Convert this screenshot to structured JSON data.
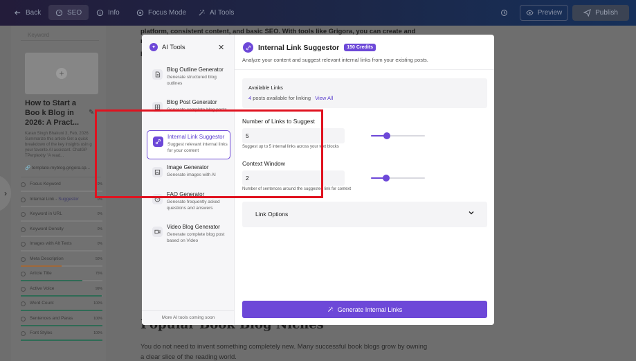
{
  "topbar": {
    "back": "Back",
    "seo": "SEO",
    "info": "Info",
    "focus_mode": "Focus Mode",
    "ai_tools": "AI Tools",
    "preview": "Preview",
    "publish": "Publish"
  },
  "sidebar": {
    "keyword_placeholder": "Keyword",
    "post_title": "How to Start a Boo k Blog in 2026: A Pract...",
    "post_excerpt": "Karan Singh Bhakuni 3, Feb, 2026 Summarize this article Get a quick breakdown of the key insights usin g your favorite AI assistant. ChatGP TPerplexity \"A read...",
    "post_url": "template-myblog.grigora.sp...",
    "checks": [
      {
        "label": "Focus Keyword",
        "value": "0%",
        "progress": 0,
        "color": "#7d7d7d"
      },
      {
        "label": "Internal Link - ",
        "highlight": "Suggestor",
        "value": "0%",
        "progress": 0,
        "color": "#7d7d7d"
      },
      {
        "label": "Keyword in URL",
        "value": "0%",
        "progress": 0,
        "color": "#7d7d7d"
      },
      {
        "label": "Keyword Density",
        "value": "0%",
        "progress": 0,
        "color": "#7d7d7d"
      },
      {
        "label": "Images with Alt Texts",
        "value": "0%",
        "progress": 0,
        "color": "#7d7d7d"
      },
      {
        "label": "Meta Description",
        "value": "50%",
        "progress": 0.5,
        "color": "#a0683a"
      },
      {
        "label": "Article Title",
        "value": "75%",
        "progress": 0.75,
        "color": "#2f6b55"
      },
      {
        "label": "Active Voice",
        "value": "99%",
        "progress": 0.99,
        "color": "#2f6b55"
      },
      {
        "label": "Word Count",
        "value": "100%",
        "progress": 1.0,
        "color": "#2f6b55"
      },
      {
        "label": "Sentences and Paras",
        "value": "100%",
        "progress": 1.0,
        "color": "#2f6b55"
      },
      {
        "label": "Font Styles",
        "value": "100%",
        "progress": 1.0,
        "color": "#2f6b55"
      }
    ]
  },
  "article": {
    "top_text": "platform, consistent content, and basic SEO. With tools like Grigora, you can create and manage a",
    "top_text_2": "b",
    "heading": "Popular Book Blog Niches",
    "paragraph": "You do not need to invent something completely new. Many successful book blogs grow by owning a clear slice of the reading world."
  },
  "modal": {
    "side_title": "AI Tools",
    "tools": [
      {
        "name": "Blog Outline Generator",
        "desc": "Generate structured blog outlines",
        "icon": "document-icon",
        "active": false
      },
      {
        "name": "Blog Post Generator",
        "desc": "Generate complete blog posts",
        "icon": "grid-icon",
        "active": false
      },
      {
        "name": "Internal Link Suggestor",
        "desc": "Suggest relevant internal links for your content",
        "icon": "link-sparkle-icon",
        "active": true
      },
      {
        "name": "Image Generator",
        "desc": "Generate images with AI",
        "icon": "image-icon",
        "active": false
      },
      {
        "name": "FAQ Generator",
        "desc": "Generate frequently asked questions and answers",
        "icon": "question-icon",
        "active": false
      },
      {
        "name": "Video Blog Generator",
        "desc": "Generate complete blog post based on Video",
        "icon": "video-icon",
        "active": false
      }
    ],
    "more_tools": "More AI tools coming soon",
    "title": "Internal Link Suggestor",
    "credits": "150 Credits",
    "subtitle": "Analyze your content and suggest relevant internal links from your existing posts.",
    "available": {
      "title": "Available Links",
      "count": "4",
      "count_text": "posts available for linking",
      "view_all": "View All"
    },
    "num_links": {
      "label": "Number of Links to Suggest",
      "value": "5",
      "slider_fraction": 0.3,
      "help": "Suggest up to 5 internal links across your text blocks"
    },
    "context": {
      "label": "Context Window",
      "value": "2",
      "slider_fraction": 0.28,
      "help": "Number of sentences around the suggested link for context"
    },
    "link_options": "Link Options",
    "generate": "Generate Internal Links"
  },
  "colors": {
    "accent": "#6d48d8",
    "highlight_box": "#e0121f"
  }
}
